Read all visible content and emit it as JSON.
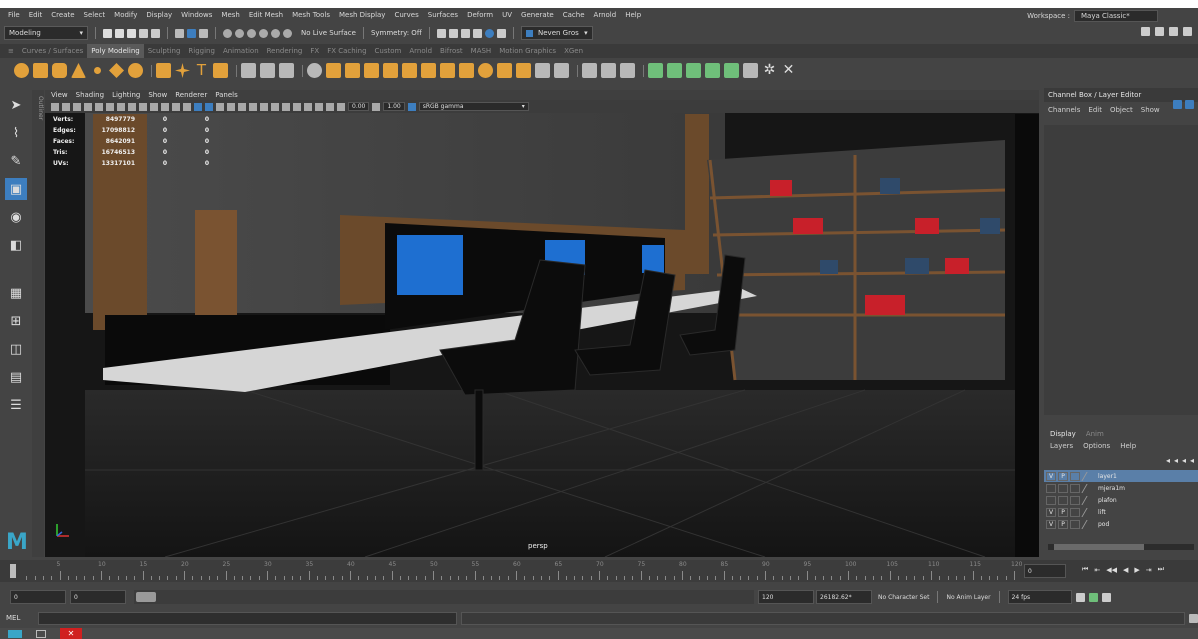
{
  "menubar": {
    "items": [
      "File",
      "Edit",
      "Create",
      "Select",
      "Modify",
      "Display",
      "Windows",
      "Mesh",
      "Edit Mesh",
      "Mesh Tools",
      "Mesh Display",
      "Curves",
      "Surfaces",
      "Deform",
      "UV",
      "Generate",
      "Cache",
      "Arnold",
      "Help"
    ],
    "workspace_label": "Workspace :",
    "workspace_value": "Maya Classic*"
  },
  "statusline": {
    "mode": "Modeling",
    "live_surface": "No Live Surface",
    "symmetry": "Symmetry: Off",
    "user": "Neven Gros"
  },
  "shelf": {
    "tabs": [
      "Curves / Surfaces",
      "Poly Modeling",
      "Sculpting",
      "Rigging",
      "Animation",
      "Rendering",
      "FX",
      "FX Caching",
      "Custom",
      "Arnold",
      "Bifrost",
      "MASH",
      "Motion Graphics",
      "XGen"
    ],
    "active_tab": "Poly Modeling"
  },
  "outliner_strip": "Outliner",
  "viewport": {
    "menu": [
      "View",
      "Shading",
      "Lighting",
      "Show",
      "Renderer",
      "Panels"
    ],
    "exposure": "0.00",
    "gamma": "1.00",
    "colorspace": "sRGB gamma",
    "camera": "persp",
    "hud": [
      {
        "key": "Verts:",
        "v1": "8497779",
        "v2": "0",
        "v3": "0"
      },
      {
        "key": "Edges:",
        "v1": "17098812",
        "v2": "0",
        "v3": "0"
      },
      {
        "key": "Faces:",
        "v1": "8642091",
        "v2": "0",
        "v3": "0"
      },
      {
        "key": "Tris:",
        "v1": "16746513",
        "v2": "0",
        "v3": "0"
      },
      {
        "key": "UVs:",
        "v1": "13317101",
        "v2": "0",
        "v3": "0"
      }
    ]
  },
  "channelbox": {
    "title": "Channel Box / Layer Editor",
    "menu": [
      "Channels",
      "Edit",
      "Object",
      "Show"
    ]
  },
  "layers": {
    "tabs": [
      "Display",
      "Anim"
    ],
    "menu": [
      "Layers",
      "Options",
      "Help"
    ],
    "rows": [
      {
        "v": "V",
        "p": "P",
        "name": "layer1",
        "selected": true
      },
      {
        "v": "",
        "p": "",
        "name": "mjera1m",
        "selected": false
      },
      {
        "v": "",
        "p": "",
        "name": "plafon",
        "selected": false
      },
      {
        "v": "V",
        "p": "P",
        "name": "lift",
        "selected": false
      },
      {
        "v": "V",
        "p": "P",
        "name": "pod",
        "selected": false
      }
    ]
  },
  "timeslider": {
    "ticks": [
      "5",
      "10",
      "15",
      "20",
      "25",
      "30",
      "35",
      "40",
      "45",
      "50",
      "55",
      "60",
      "65",
      "70",
      "75",
      "80",
      "85",
      "90",
      "95",
      "100",
      "105",
      "110",
      "115",
      "120"
    ],
    "current_frame": "0"
  },
  "rangeslider": {
    "start": "0",
    "anim_start": "0",
    "anim_end": "120",
    "end_value": "26182.62*",
    "character_set": "No Character Set",
    "anim_layer": "No Anim Layer",
    "fps": "24 fps"
  },
  "cmdline": {
    "label": "MEL"
  },
  "colors": {
    "accent_blue": "#3d7ebf",
    "shelf_orange": "#e2a13b",
    "monitor_blue": "#1e6fd1",
    "book_red": "#c8202a"
  }
}
